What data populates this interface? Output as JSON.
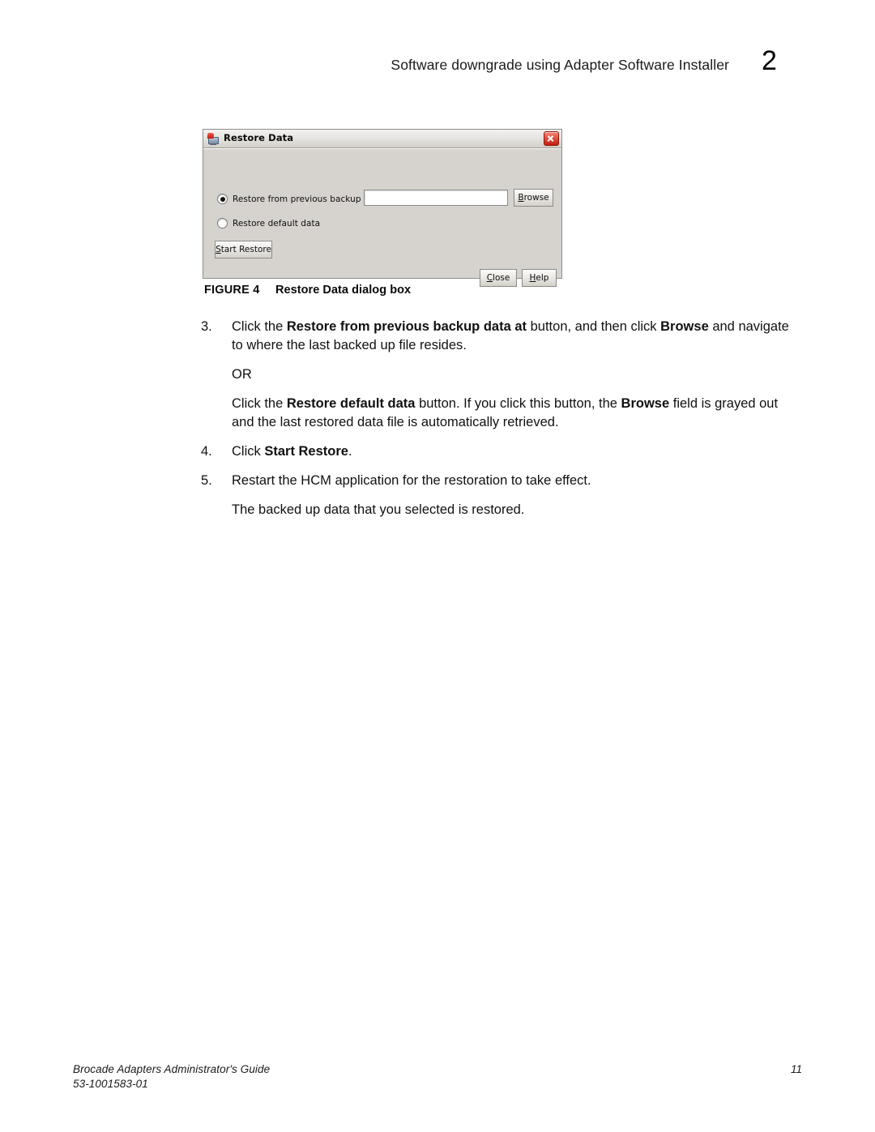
{
  "header": {
    "title": "Software downgrade using Adapter Software Installer",
    "chapter": "2"
  },
  "figure": {
    "dialog": {
      "title": "Restore Data",
      "title_icon": "computer-restore-icon",
      "close_icon": "close-icon",
      "options": [
        {
          "label": "Restore from previous backup data at",
          "selected": true
        },
        {
          "label": "Restore default data",
          "selected": false
        }
      ],
      "path_field_value": "",
      "path_field_placeholder": "",
      "buttons": {
        "browse": {
          "mnemonic": "B",
          "rest": "rowse"
        },
        "start_restore": {
          "mnemonic": "S",
          "rest": "tart Restore"
        },
        "close": {
          "mnemonic": "C",
          "rest": "lose"
        },
        "help": {
          "mnemonic": "H",
          "rest": "elp"
        }
      }
    },
    "caption_label": "FIGURE 4",
    "caption_title": "Restore Data dialog box"
  },
  "procedure": {
    "step3": {
      "num": "3.",
      "t1": "Click the ",
      "b1": "Restore from previous backup data at",
      "t2": " button, and then click ",
      "b2": "Browse",
      "t3": " and navigate to where the last backed up file resides."
    },
    "or_text": "OR",
    "step3_alt": {
      "t1": "Click the ",
      "b1": "Restore default data",
      "t2": " button. If you click this button, the ",
      "b2": "Browse",
      "t3": " field is grayed out and the last restored data file is automatically retrieved."
    },
    "step4": {
      "num": "4.",
      "t1": "Click ",
      "b1": "Start Restore",
      "t2": "."
    },
    "step5": {
      "num": "5.",
      "t1": "Restart the HCM application for the restoration to take effect."
    },
    "step5_result": "The backed up data that you selected is restored."
  },
  "footer": {
    "guide": "Brocade Adapters Administrator's Guide",
    "doc_id": "53-1001583-01",
    "page_number": "11"
  },
  "colors": {
    "dialog_face": "#d6d3ce",
    "close_red": "#c01f0e",
    "text": "#111111"
  }
}
